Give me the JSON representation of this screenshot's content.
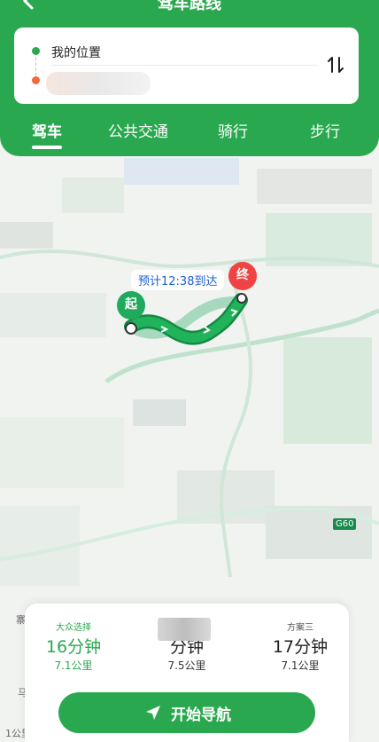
{
  "header": {
    "title": "驾车路线",
    "origin": "我的位置",
    "tabs": [
      "驾车",
      "公共交通",
      "骑行",
      "步行"
    ]
  },
  "map": {
    "eta": "预计12:38到达",
    "start_pin": "起",
    "end_pin": "终",
    "road_badge": "G60",
    "label_left": "寨",
    "label_left2": "马",
    "scale": "1公里"
  },
  "plans": [
    {
      "tag": "大众选择",
      "time": "16分钟",
      "distance": "7.1公里"
    },
    {
      "tag": "",
      "time": "分钟",
      "distance": "7.5公里"
    },
    {
      "tag": "方案三",
      "time": "17分钟",
      "distance": "7.1公里"
    }
  ],
  "navigation": {
    "button_label": "开始导航"
  },
  "colors": {
    "brand": "#2aa84f",
    "start": "#1faa5c",
    "end": "#f04343"
  }
}
